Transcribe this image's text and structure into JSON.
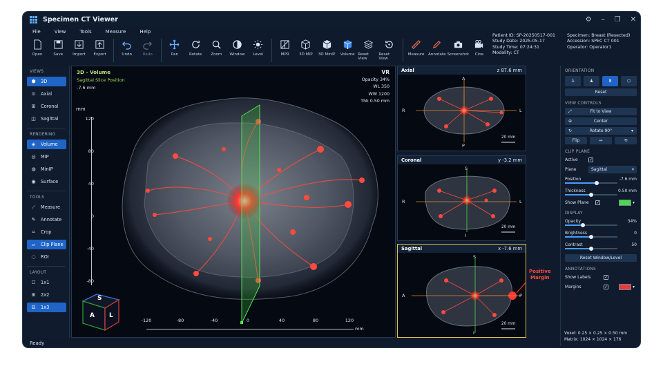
{
  "app": {
    "title": "Specimen CT Viewer"
  },
  "menu": [
    "File",
    "View",
    "Tools",
    "Measure",
    "Help"
  ],
  "toolbar": {
    "items": [
      "Open",
      "Save",
      "Import",
      "Export",
      "Undo",
      "Redo",
      "Pan",
      "Rotate",
      "Zoom",
      "Window",
      "Level",
      "MPR",
      "3D MIP",
      "3D MinIP",
      "Volume",
      "Reset View",
      "Reset View",
      "Measure",
      "Annotate",
      "Screenshot",
      "Cine"
    ]
  },
  "patient": {
    "id": "Patient ID: SP-20250517-001",
    "study_date": "Study Date: 2025-05-17",
    "study_time": "Study Time: 07:24:31",
    "modality": "Modality: CT",
    "specimen": "Specimen: Breast (Resected)",
    "accession": "Accession: SPEC CT 001",
    "operator": "Operator: Operator1"
  },
  "left_panel": {
    "views_title": "VIEWS",
    "views": [
      "3D",
      "Axial",
      "Coronal",
      "Sagittal"
    ],
    "rendering_title": "RENDERING",
    "rendering": [
      "Volume",
      "MIP",
      "MinIP",
      "Surface"
    ],
    "tools_title": "TOOLS",
    "tools": [
      "Measure",
      "Annotate",
      "Crop",
      "Clip Plane",
      "ROI"
    ],
    "layout_title": "LAYOUT",
    "layouts": [
      "1x1",
      "2x2",
      "1x3"
    ]
  },
  "viewport3d": {
    "title": "3D - Volume",
    "subtitle": "Sagittal Slice Position",
    "position": "-7.6 mm",
    "mode": "VR",
    "opacity": "Opacity 34%",
    "wl": "WL 350",
    "ww": "WW 1200",
    "thk": "Thk 0.50 mm",
    "unit": "mm",
    "yticks": [
      "120",
      "80",
      "40",
      "0",
      "-40",
      "-80"
    ],
    "xticks": [
      "-120",
      "-80",
      "-40",
      "0",
      "40",
      "80",
      "120"
    ],
    "xunit": "mm",
    "cube": {
      "s": "S",
      "a": "A",
      "l": "L"
    }
  },
  "views": {
    "axial": {
      "title": "Axial",
      "pos": "z 87.6 mm",
      "top": "A",
      "bottom": "P",
      "left": "R",
      "right": "L",
      "scale": "20 mm"
    },
    "coronal": {
      "title": "Coronal",
      "pos": "y -3.2 mm",
      "top": "S",
      "bottom": "I",
      "left": "R",
      "right": "L",
      "scale": "20 mm"
    },
    "sagittal": {
      "title": "Sagittal",
      "pos": "x -7.6 mm",
      "top": "S",
      "bottom": "I",
      "left": "A",
      "right": "P",
      "scale": "20 mm",
      "annotation_line1": "Positive",
      "annotation_line2": "Margin"
    }
  },
  "right_panel": {
    "orientation_title": "ORIENTATION",
    "reset_label": "Reset",
    "view_controls_title": "VIEW CONTROLS",
    "fit_label": "Fit to View",
    "center_label": "Center",
    "rotate_label": "Rotate 90°",
    "flip_label": "Flip",
    "clip_title": "CLIP PLANE",
    "active_label": "Active",
    "plane_label": "Plane",
    "plane_value": "Sagittal",
    "position_label": "Position",
    "position_value": "-7.6 mm",
    "position_level": 0.6,
    "thickness_label": "Thickness",
    "thickness_value": "0.50 mm",
    "thickness_level": 0.5,
    "show_plane_label": "Show Plane",
    "plane_color": "#4cd94a",
    "display_title": "DISPLAY",
    "opacity_label": "Opacity",
    "opacity_value": "34%",
    "opacity_level": 0.34,
    "brightness_label": "Brightness",
    "brightness_value": "0",
    "brightness_level": 0.5,
    "contrast_label": "Contrast",
    "contrast_value": "50",
    "contrast_level": 0.5,
    "reset_wl_label": "Reset Window/Level",
    "annotations_title": "ANNOTATIONS",
    "show_labels_label": "Show Labels",
    "margins_label": "Margins",
    "margin_color": "#e83a3a",
    "voxel": "Voxel: 0.25 × 0.25 × 0.50 mm",
    "matrix": "Matrix: 1024 × 1024 × 176"
  },
  "status": "Ready"
}
